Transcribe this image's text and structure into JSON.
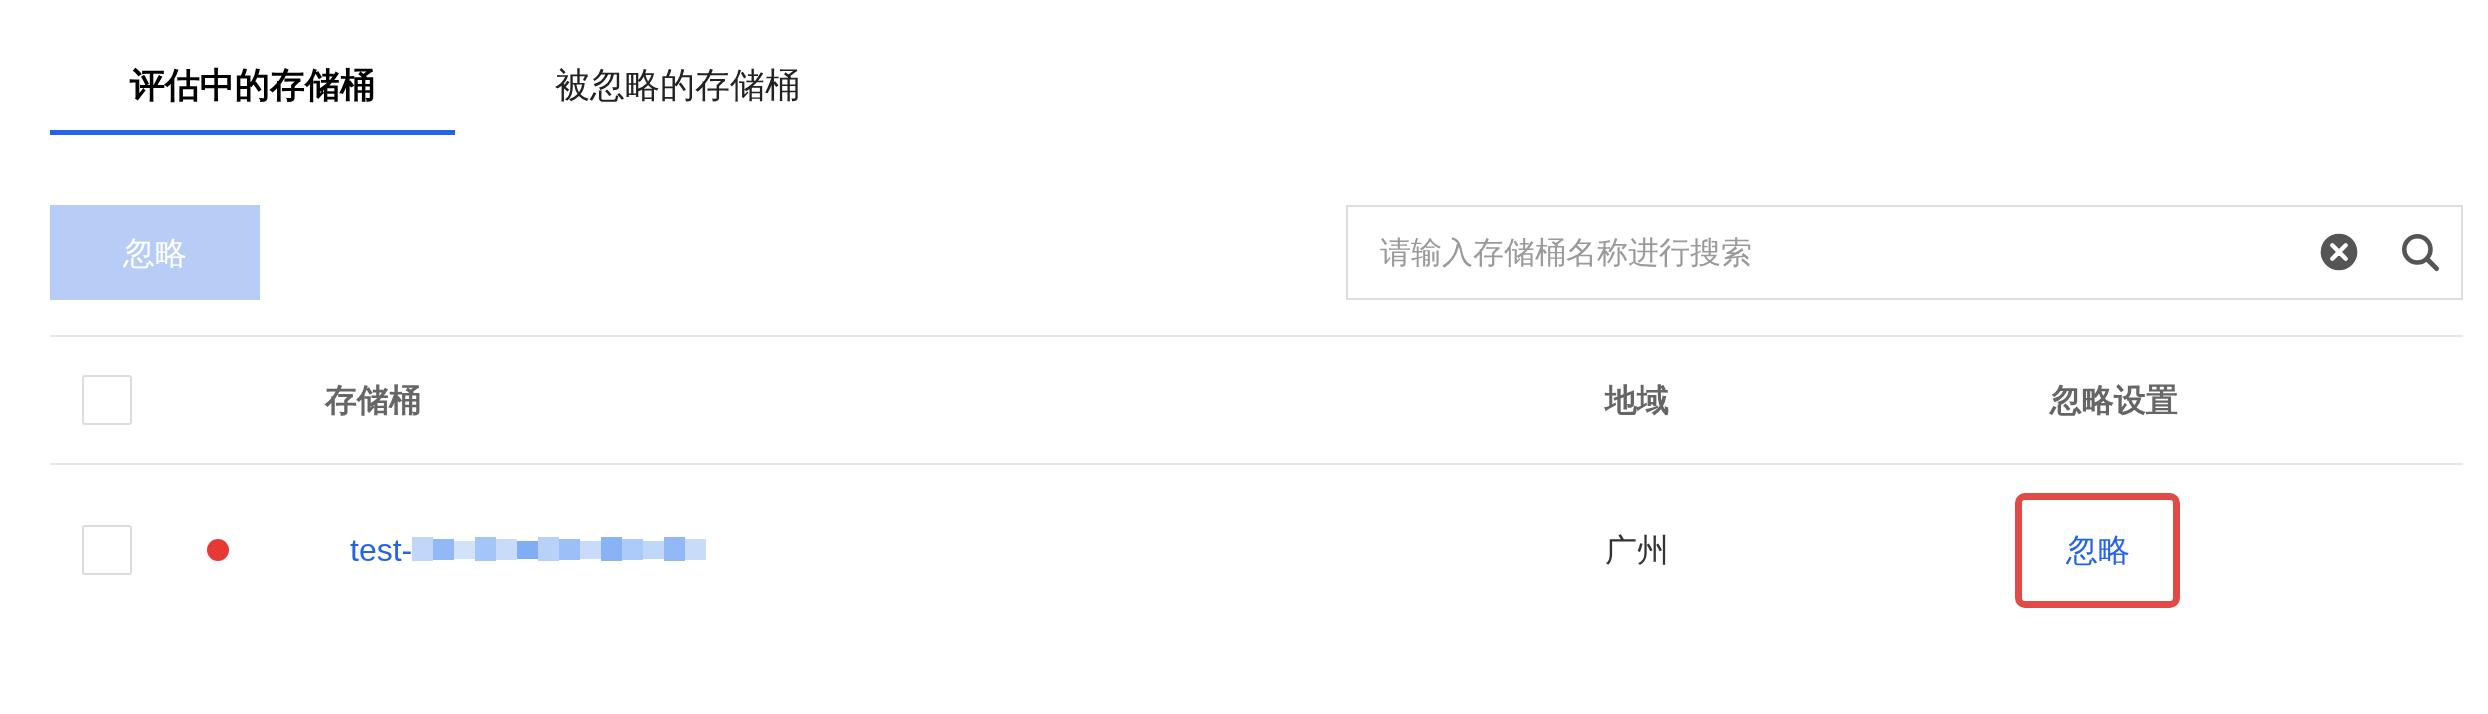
{
  "tabs": [
    {
      "label": "评估中的存储桶",
      "selected": true
    },
    {
      "label": "被忽略的存储桶",
      "selected": false
    }
  ],
  "toolbar": {
    "ignore_button": {
      "label": "忽略",
      "disabled": true
    },
    "search": {
      "placeholder": "请输入存储桶名称进行搜索"
    }
  },
  "table": {
    "header_checked": false,
    "columns": [
      "存储桶",
      "地域",
      "忽略设置"
    ],
    "rows": [
      {
        "checked": false,
        "color": "#e53935",
        "name": "test-",
        "region": "广州",
        "action": "忽略",
        "highlighted": true
      }
    ]
  }
}
